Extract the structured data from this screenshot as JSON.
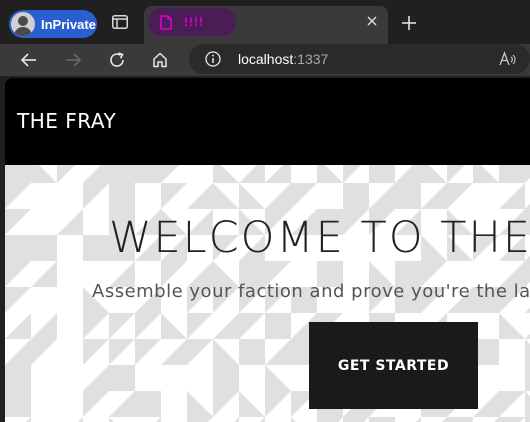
{
  "browser": {
    "profile_label": "InPrivate",
    "tab": {
      "title": "!!!!",
      "title_color": "#e000d0",
      "highlight_color": "#4a1d56"
    },
    "address": {
      "host": "localhost",
      "port": ":1337"
    },
    "icons": {
      "profile": "avatar-icon",
      "tabs": "tab-actions-icon",
      "tab_page": "page-icon",
      "close": "close-icon",
      "new_tab": "plus-icon",
      "back": "back-arrow-icon",
      "forward": "forward-arrow-icon",
      "refresh": "refresh-icon",
      "home": "home-icon",
      "site_info": "info-icon",
      "read_aloud": "read-aloud-icon"
    },
    "colors": {
      "inprivate_badge": "#2b5fd0",
      "chrome_dark": "#202020",
      "toolbar": "#3a3a3a"
    }
  },
  "site": {
    "brand": "THE FRAY",
    "hero": {
      "title": "WELCOME TO THE FRAY",
      "subtitle": "Assemble your faction and prove you're the last one standing",
      "cta_label": "GET STARTED"
    },
    "colors": {
      "nav_bg": "#000000",
      "cta_bg": "#1a1a1a",
      "pattern": "#e0e0e0"
    }
  }
}
